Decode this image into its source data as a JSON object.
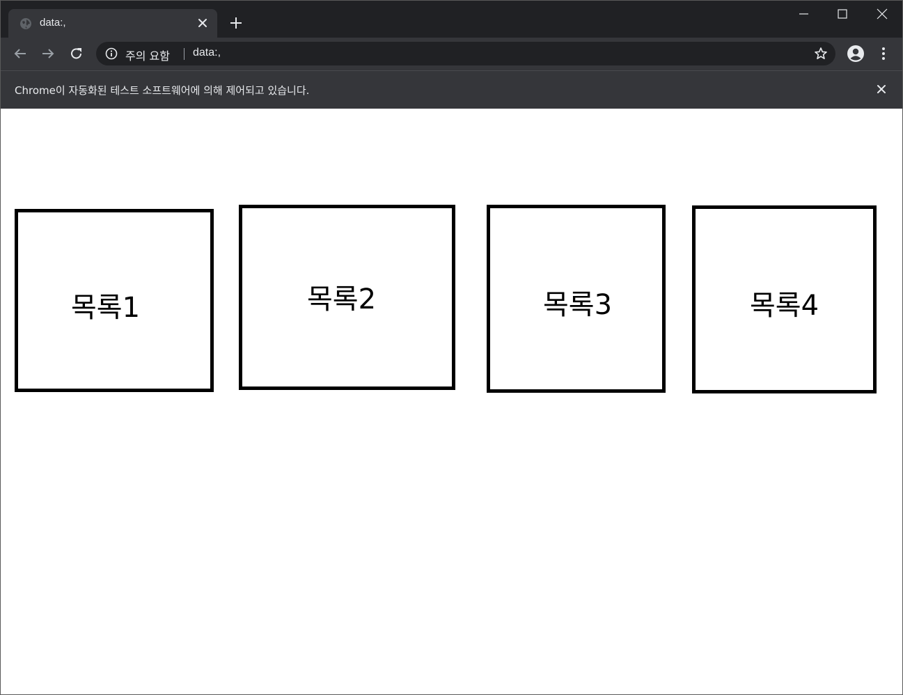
{
  "browser": {
    "tab": {
      "title": "data:,"
    },
    "address_bar": {
      "security_label": "주의 요함",
      "url": "data:,"
    },
    "infobar": {
      "message": "Chrome이 자동화된 테스트 소프트웨어에 의해 제어되고 있습니다."
    },
    "icons": [
      "globe-icon",
      "close-icon",
      "plus-icon",
      "minimize-icon",
      "maximize-icon",
      "back-arrow-icon",
      "forward-arrow-icon",
      "reload-icon",
      "info-icon",
      "star-icon",
      "profile-icon",
      "kebab-menu-icon"
    ]
  },
  "page": {
    "boxes": [
      {
        "label": "목록1"
      },
      {
        "label": "목록2"
      },
      {
        "label": "목록3"
      },
      {
        "label": "목록4"
      }
    ]
  },
  "colors": {
    "titlebar": "#202124",
    "toolbar": "#35363a",
    "text_light": "#e8eaed",
    "box_border": "#000000",
    "page_background": "#ffffff"
  }
}
